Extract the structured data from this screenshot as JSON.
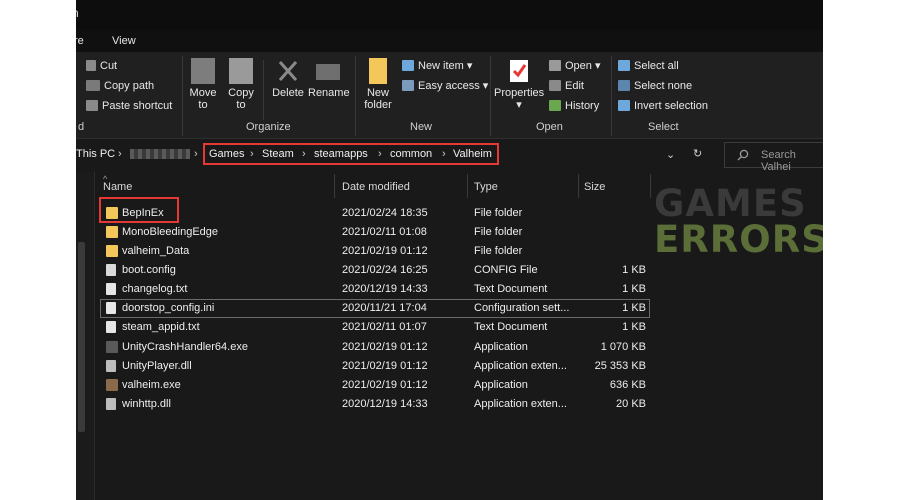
{
  "window": {
    "title_fragment": "n"
  },
  "menu_tabs": [
    "re",
    "View"
  ],
  "ribbon": {
    "clipboard": {
      "group_label": "d",
      "cut": "Cut",
      "copy_path": "Copy path",
      "paste_shortcut": "Paste shortcut"
    },
    "organize": {
      "group_label": "Organize",
      "move_to": [
        "Move",
        "to"
      ],
      "copy_to": [
        "Copy",
        "to"
      ],
      "delete": "Delete",
      "rename": "Rename"
    },
    "new": {
      "group_label": "New",
      "new_folder": [
        "New",
        "folder"
      ],
      "new_item": "New item",
      "easy_access": "Easy access"
    },
    "open": {
      "group_label": "Open",
      "properties": "Properties",
      "open": "Open",
      "edit": "Edit",
      "history": "History"
    },
    "select": {
      "group_label": "Select",
      "select_all": "Select all",
      "select_none": "Select none",
      "invert_selection": "Invert selection"
    }
  },
  "address_bar": {
    "this_pc": "This PC",
    "path": [
      "Games",
      "Steam",
      "steamapps",
      "common",
      "Valheim"
    ],
    "search_placeholder": "Search Valhei"
  },
  "columns": {
    "name": "Name",
    "date_modified": "Date modified",
    "type": "Type",
    "size": "Size"
  },
  "files": [
    {
      "name": "BepInEx",
      "date": "2021/02/24 18:35",
      "type": "File folder",
      "size": "",
      "icon": "folder-icon"
    },
    {
      "name": "MonoBleedingEdge",
      "date": "2021/02/11 01:08",
      "type": "File folder",
      "size": "",
      "icon": "folder-icon"
    },
    {
      "name": "valheim_Data",
      "date": "2021/02/19 01:12",
      "type": "File folder",
      "size": "",
      "icon": "folder-icon"
    },
    {
      "name": "boot.config",
      "date": "2021/02/24 16:25",
      "type": "CONFIG File",
      "size": "1 KB",
      "icon": "file-icon"
    },
    {
      "name": "changelog.txt",
      "date": "2020/12/19 14:33",
      "type": "Text Document",
      "size": "1 KB",
      "icon": "text-file-icon"
    },
    {
      "name": "doorstop_config.ini",
      "date": "2020/11/21 17:04",
      "type": "Configuration sett...",
      "size": "1 KB",
      "icon": "config-file-icon"
    },
    {
      "name": "steam_appid.txt",
      "date": "2021/02/11 01:07",
      "type": "Text Document",
      "size": "1 KB",
      "icon": "text-file-icon"
    },
    {
      "name": "UnityCrashHandler64.exe",
      "date": "2021/02/19 01:12",
      "type": "Application",
      "size": "1 070 KB",
      "icon": "app-icon"
    },
    {
      "name": "UnityPlayer.dll",
      "date": "2021/02/19 01:12",
      "type": "Application exten...",
      "size": "25 353 KB",
      "icon": "dll-icon"
    },
    {
      "name": "valheim.exe",
      "date": "2021/02/19 01:12",
      "type": "Application",
      "size": "636 KB",
      "icon": "valheim-app-icon"
    },
    {
      "name": "winhttp.dll",
      "date": "2020/12/19 14:33",
      "type": "Application exten...",
      "size": "20 KB",
      "icon": "dll-icon"
    }
  ],
  "watermark": {
    "line1": "GAMES",
    "line2": "ERRORS"
  },
  "colors": {
    "highlight": "#e53935",
    "folder": "#f3c75a",
    "watermark_green": "#5c6e38",
    "background": "#191919"
  }
}
